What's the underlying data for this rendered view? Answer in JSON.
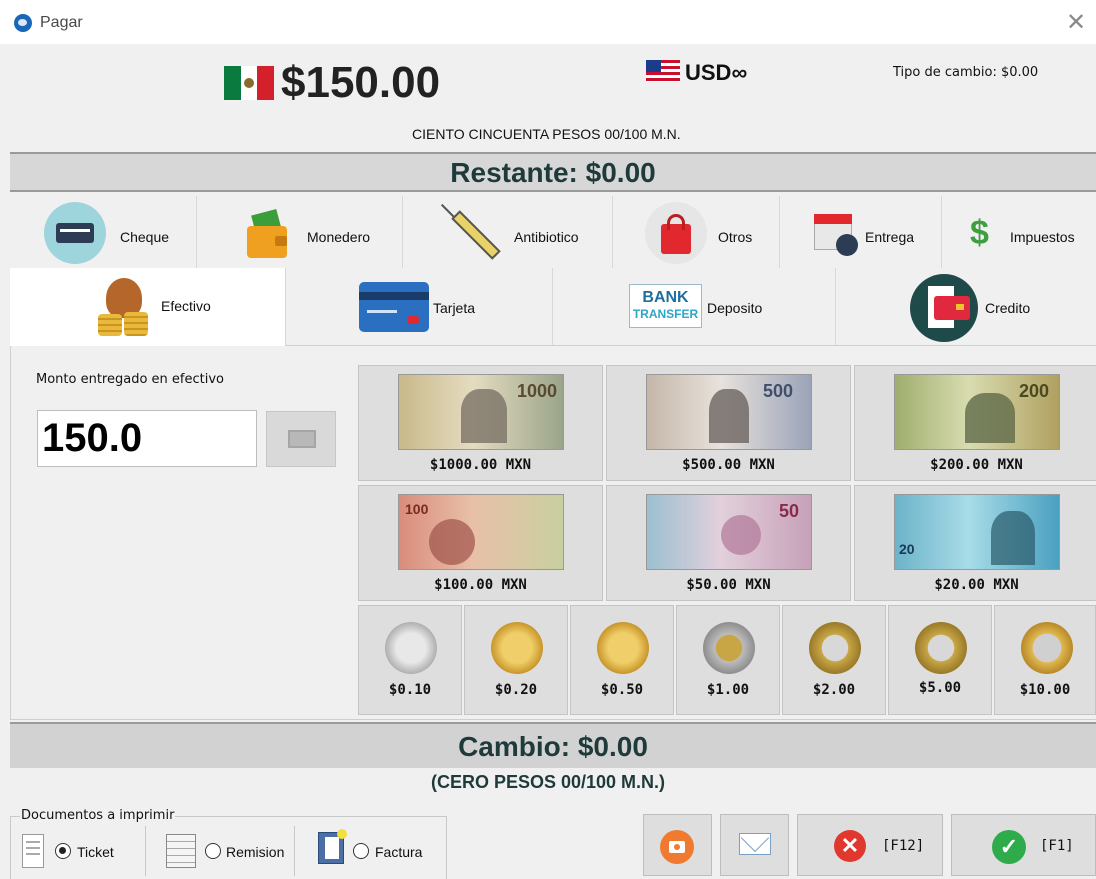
{
  "window": {
    "title": "Pagar",
    "close_glyph": "✕",
    "app_icon": "app-logo-icon"
  },
  "header": {
    "total": "$150.00",
    "currency_icon": "mexico-flag-icon",
    "alt_currency": "USD∞",
    "alt_currency_icon": "usa-flag-icon",
    "tipo_cambio": "Tipo de cambio: $0.00",
    "total_words": "CIENTO CINCUENTA PESOS  00/100 M.N."
  },
  "restante": "Restante: $0.00",
  "methods_row1": [
    {
      "label": "Cheque",
      "icon": "cheque-icon"
    },
    {
      "label": "Monedero",
      "icon": "wallet-icon"
    },
    {
      "label": "Antibiotico",
      "icon": "syringe-icon"
    },
    {
      "label": "Otros",
      "icon": "shopping-bag-icon"
    },
    {
      "label": "Entrega",
      "icon": "calendar-clock-icon"
    },
    {
      "label": "Impuestos",
      "icon": "dollar-sign-icon"
    }
  ],
  "methods_row2": [
    {
      "label": "Efectivo",
      "icon": "money-bag-icon",
      "active": true
    },
    {
      "label": "Tarjeta",
      "icon": "credit-card-icon"
    },
    {
      "label": "Deposito",
      "icon": "bank-transfer-icon",
      "badge_line1": "BANK",
      "badge_line2": "TRANSFER"
    },
    {
      "label": "Credito",
      "icon": "credit-document-icon"
    }
  ],
  "cash": {
    "label": "Monto entregado en efectivo",
    "value": "150.0",
    "bills": [
      {
        "label": "$1000.00 MXN",
        "denom": "1000",
        "color": "#c9b98a"
      },
      {
        "label": "$500.00 MXN",
        "denom": "500",
        "color": "#c4b7a9"
      },
      {
        "label": "$200.00 MXN",
        "denom": "200",
        "color": "#9fae6e"
      },
      {
        "label": "$100.00 MXN",
        "denom": "100",
        "color": "#d98c7c"
      },
      {
        "label": "$50.00 MXN",
        "denom": "50",
        "color": "#c7a1b8"
      },
      {
        "label": "$20.00 MXN",
        "denom": "20",
        "color": "#6db3c9"
      }
    ],
    "coins": [
      {
        "label": "$0.10",
        "type": "silver"
      },
      {
        "label": "$0.20",
        "type": "gold"
      },
      {
        "label": "$0.50",
        "type": "gold"
      },
      {
        "label": "$1.00",
        "type": "bimetal-gold-center"
      },
      {
        "label": "$2.00",
        "type": "bimetal-silver-center"
      },
      {
        "label": "$5.00",
        "type": "bimetal-silver-center"
      },
      {
        "label": "$10.00",
        "type": "bimetal-gold-ring"
      }
    ]
  },
  "cambio": "Cambio: $0.00",
  "cambio_words": "(CERO PESOS  00/100 M.N.)",
  "documents": {
    "label": "Documentos a imprimir",
    "options": [
      {
        "label": "Ticket",
        "icon": "receipt-icon",
        "selected": true
      },
      {
        "label": "Remision",
        "icon": "spreadsheet-icon",
        "selected": false
      },
      {
        "label": "Factura",
        "icon": "invoice-icon",
        "selected": false
      }
    ]
  },
  "actions": {
    "camera_icon": "camera-icon",
    "email_icon": "email-icon",
    "cancel_label": "[F12]",
    "cancel_icon": "cancel-x-icon",
    "accept_label": "[F1]",
    "accept_icon": "check-icon"
  }
}
